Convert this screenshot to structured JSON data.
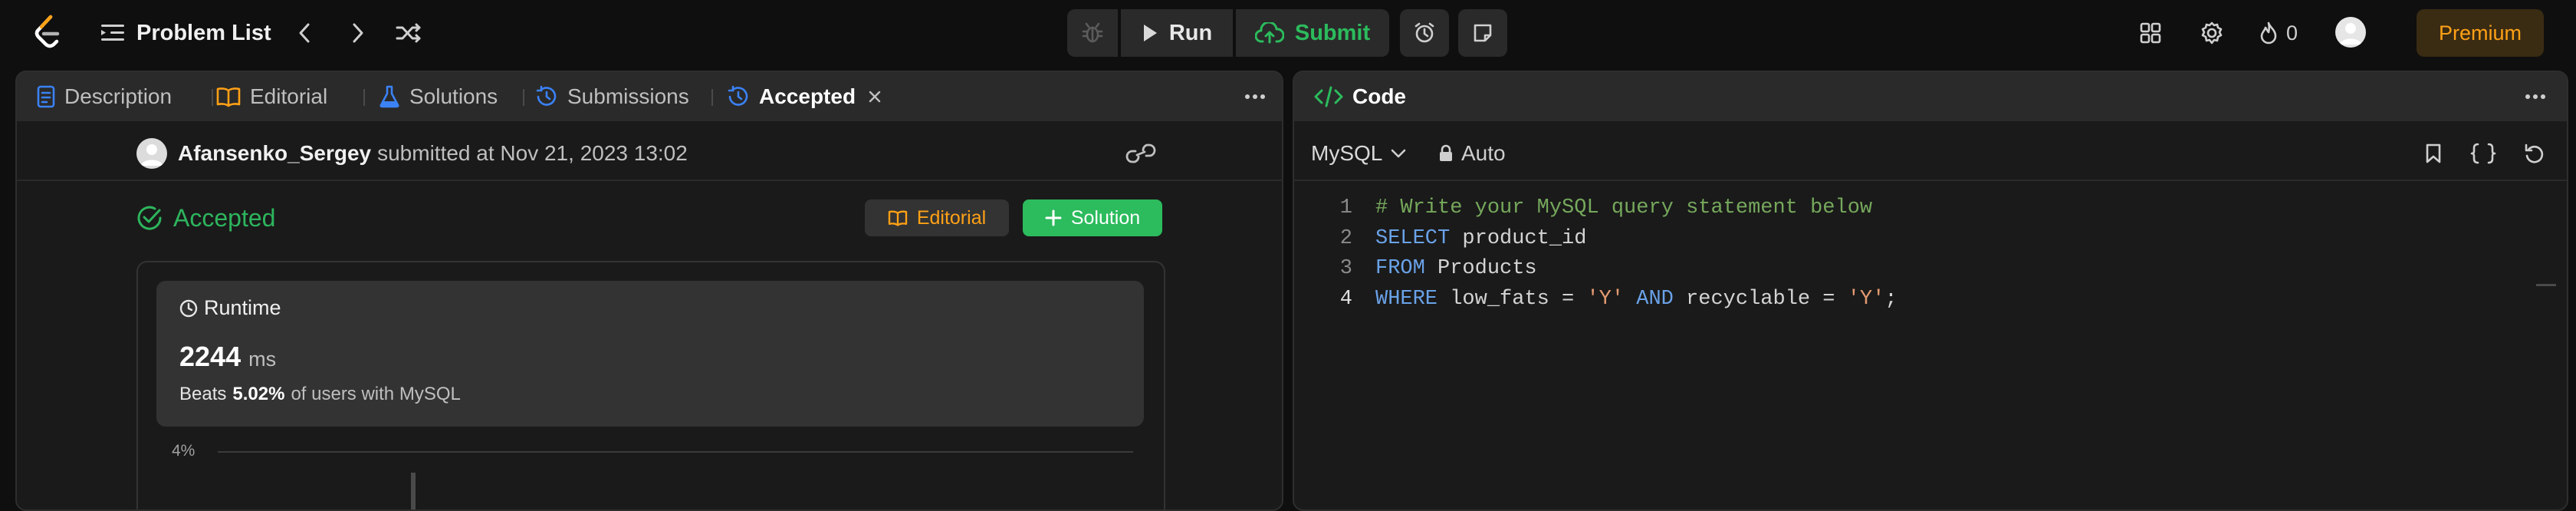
{
  "topbar": {
    "problem_list": "Problem List",
    "run": "Run",
    "submit": "Submit",
    "streak": "0",
    "premium": "Premium"
  },
  "left_tabs": {
    "description": "Description",
    "editorial": "Editorial",
    "solutions": "Solutions",
    "submissions": "Submissions",
    "accepted": "Accepted"
  },
  "submission": {
    "user": "Afansenko_Sergey",
    "submitted_text": "submitted at Nov 21, 2023 13:02",
    "status": "Accepted",
    "editorial_btn": "Editorial",
    "solution_btn": "Solution"
  },
  "runtime": {
    "title": "Runtime",
    "value": "2244",
    "unit": "ms",
    "beats_prefix": "Beats",
    "beats_pct": "5.02%",
    "beats_suffix": "of users with MySQL",
    "axis_label": "4%"
  },
  "code_panel": {
    "title": "Code",
    "language": "MySQL",
    "mode": "Auto",
    "line_numbers": [
      "1",
      "2",
      "3",
      "4"
    ],
    "comment": "# Write your MySQL query statement below",
    "kw_select": "SELECT",
    "select_rest": " product_id",
    "kw_from": "FROM",
    "from_rest": " Products",
    "kw_where": "WHERE",
    "where_1": " low_fats = ",
    "str_1": "'Y'",
    "kw_and": " AND",
    "where_2": " recyclable = ",
    "str_2": "'Y'",
    "semicolon": ";"
  },
  "colors": {
    "accent_green": "#2cbb5d",
    "accepted_green": "#2db55d",
    "editorial_orange": "#ffa116",
    "blue": "#3b82f6",
    "premium_text": "#ffa116",
    "panel_bg": "#1a1a1a",
    "header_bg": "#2a2a2a"
  }
}
